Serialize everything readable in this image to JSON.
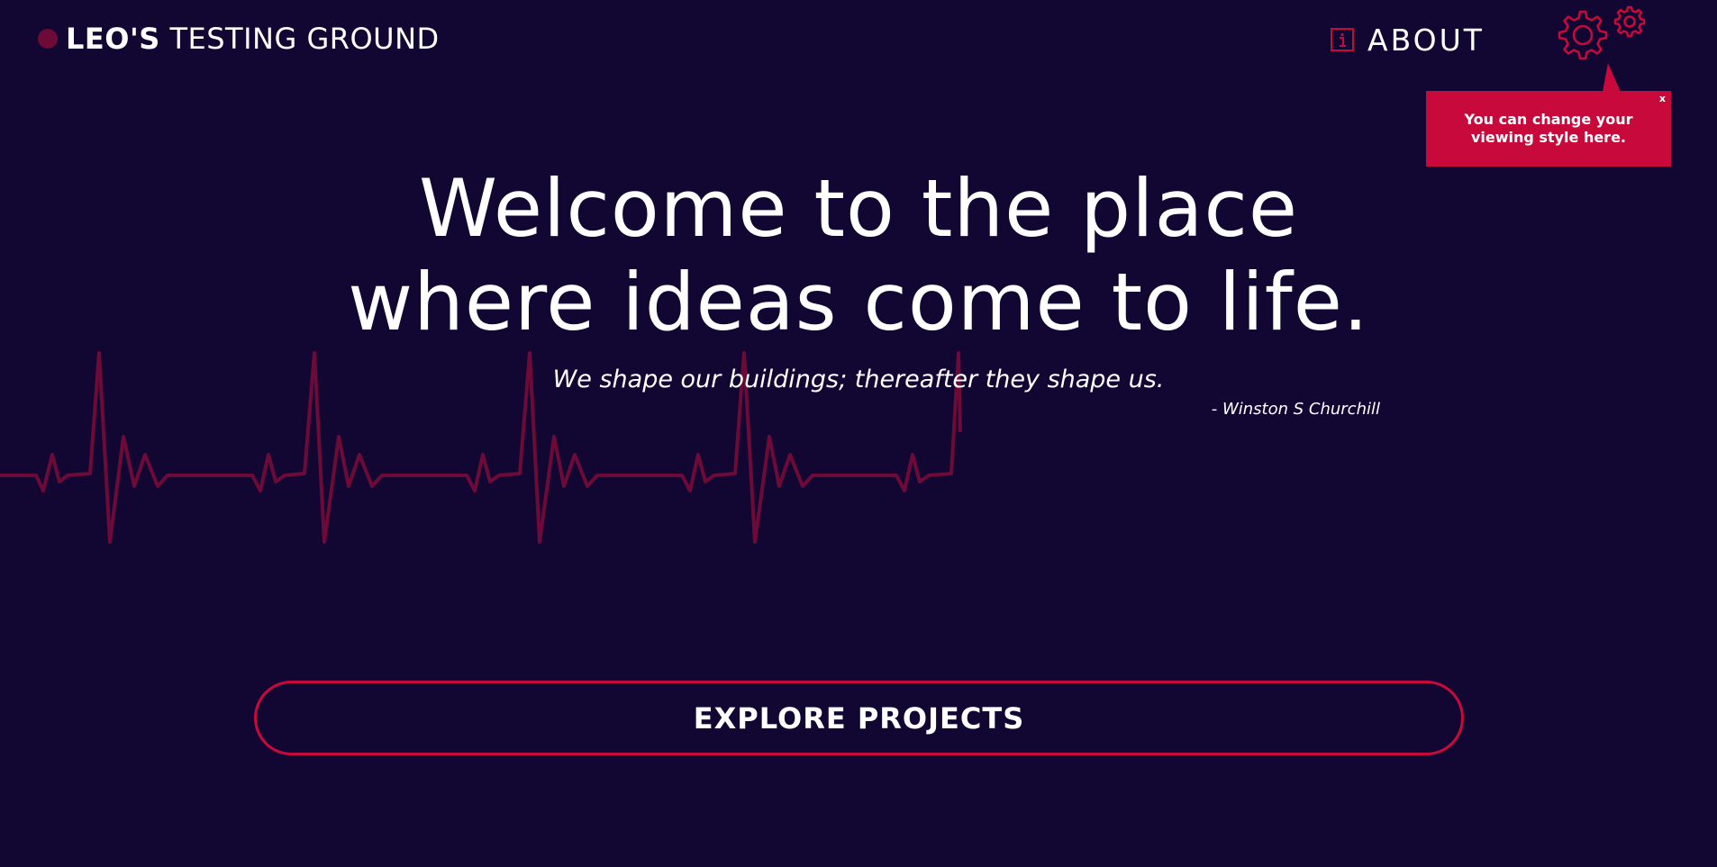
{
  "header": {
    "brand_strong": "LEO'S",
    "brand_light": " TESTING GROUND",
    "nav": {
      "about_label": "ABOUT",
      "about_icon": "info-icon"
    },
    "settings_icon": "gears-icon"
  },
  "tooltip": {
    "text": "You can change your viewing style here.",
    "close_label": "x"
  },
  "hero": {
    "title_line1": "Welcome to the place",
    "title_line2": "where ideas come to life.",
    "quote": "We shape our buildings; thereafter they shape us.",
    "quote_author": "- Winston S Churchill"
  },
  "cta": {
    "label": "EXPLORE PROJECTS"
  },
  "colors": {
    "background": "#120733",
    "accent": "#c8093b",
    "heartbeat": "#6e0a38",
    "text": "#ffffff"
  }
}
